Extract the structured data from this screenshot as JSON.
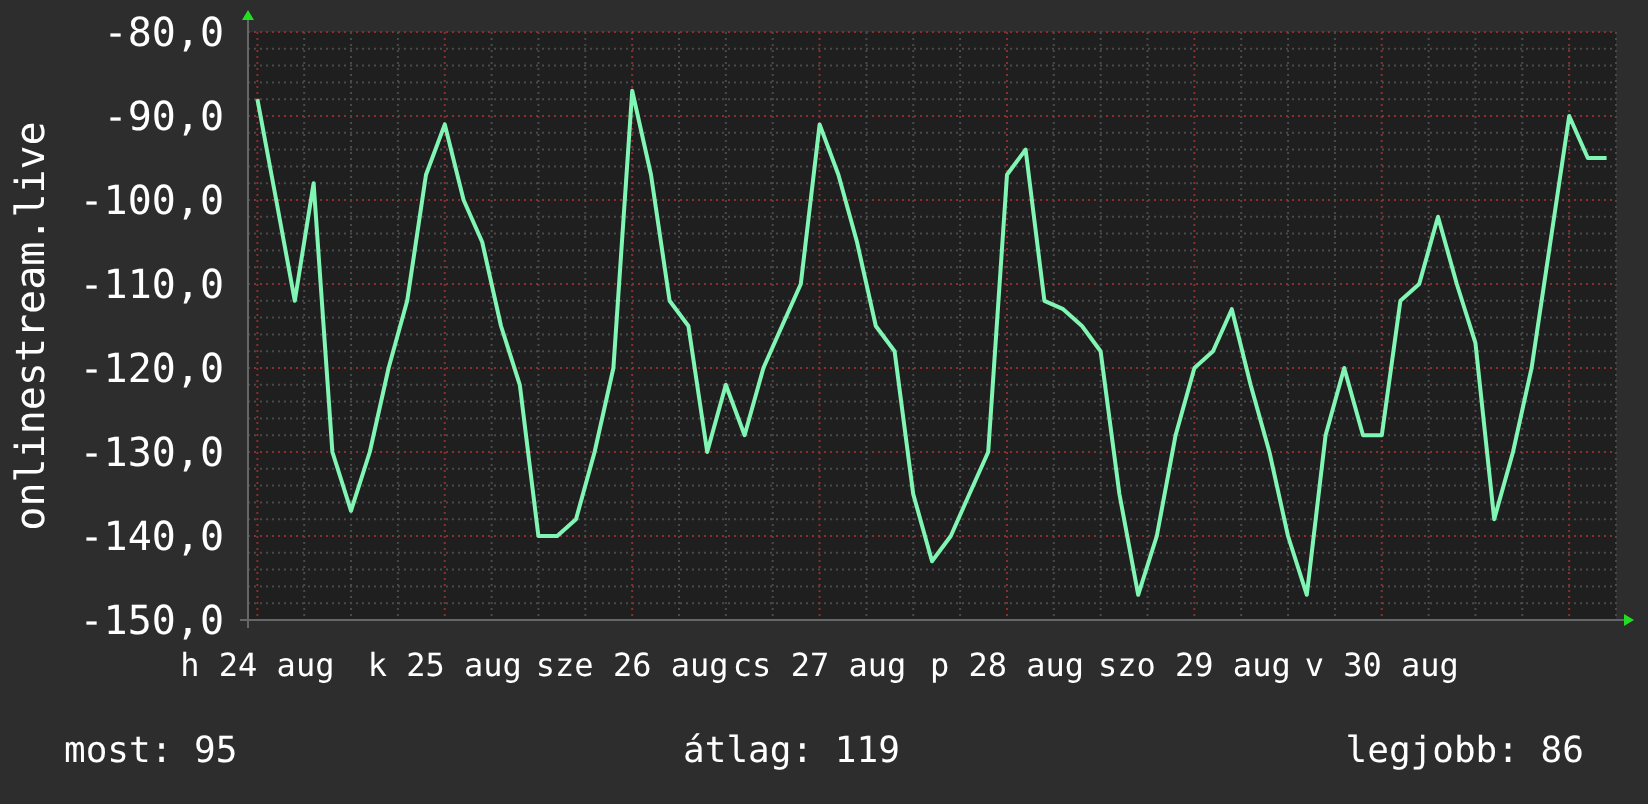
{
  "chart_data": {
    "type": "line",
    "grid": true,
    "ylabel": "onlinestream.live",
    "categories": [
      "h 24 aug",
      null,
      null,
      null,
      null,
      null,
      null,
      null,
      null,
      null,
      "k 25 aug",
      null,
      null,
      null,
      null,
      null,
      null,
      null,
      null,
      null,
      "sze 26 aug",
      null,
      null,
      null,
      null,
      null,
      null,
      null,
      null,
      null,
      "cs 27 aug",
      null,
      null,
      null,
      null,
      null,
      null,
      null,
      null,
      null,
      "p 28 aug",
      null,
      null,
      null,
      null,
      null,
      null,
      null,
      null,
      null,
      "szo 29 aug",
      null,
      null,
      null,
      null,
      null,
      null,
      null,
      null,
      null,
      "v 30 aug",
      null,
      null,
      null,
      null,
      null,
      null,
      null,
      null,
      null,
      null,
      null,
      null
    ],
    "series": [
      {
        "color": "#80f5b4",
        "values": [
          -88,
          -100,
          -112,
          -98,
          -130,
          -137,
          -130,
          -120,
          -112,
          -97,
          -91,
          -100,
          -105,
          -115,
          -122,
          -140,
          -140,
          -138,
          -130,
          -120,
          -87,
          -97,
          -112,
          -115,
          -130,
          -122,
          -128,
          -120,
          -115,
          -110,
          -91,
          -97,
          -105,
          -115,
          -118,
          -135,
          -143,
          -140,
          -135,
          -130,
          -97,
          -94,
          -112,
          -113,
          -115,
          -118,
          -135,
          -147,
          -140,
          -128,
          -120,
          -118,
          -113,
          -122,
          -130,
          -140,
          -147,
          -128,
          -120,
          -128,
          -128,
          -112,
          -110,
          -102,
          -110,
          -117,
          -138,
          -130,
          -120,
          -105,
          -90,
          -95,
          -95
        ]
      }
    ],
    "ylim": [
      -150,
      -80
    ],
    "yticks": [
      {
        "value": -80,
        "label": "-80,0"
      },
      {
        "value": -90,
        "label": "-90,0"
      },
      {
        "value": -100,
        "label": "-100,0"
      },
      {
        "value": -110,
        "label": "-110,0"
      },
      {
        "value": -120,
        "label": "-120,0"
      },
      {
        "value": -130,
        "label": "-130,0"
      },
      {
        "value": -140,
        "label": "-140,0"
      },
      {
        "value": -150,
        "label": "-150,0"
      }
    ]
  },
  "legend": [
    {
      "label": "most:",
      "value": "95"
    },
    {
      "label": "átlag:",
      "value": "119"
    },
    {
      "label": "legjobb:",
      "value": "86"
    }
  ]
}
